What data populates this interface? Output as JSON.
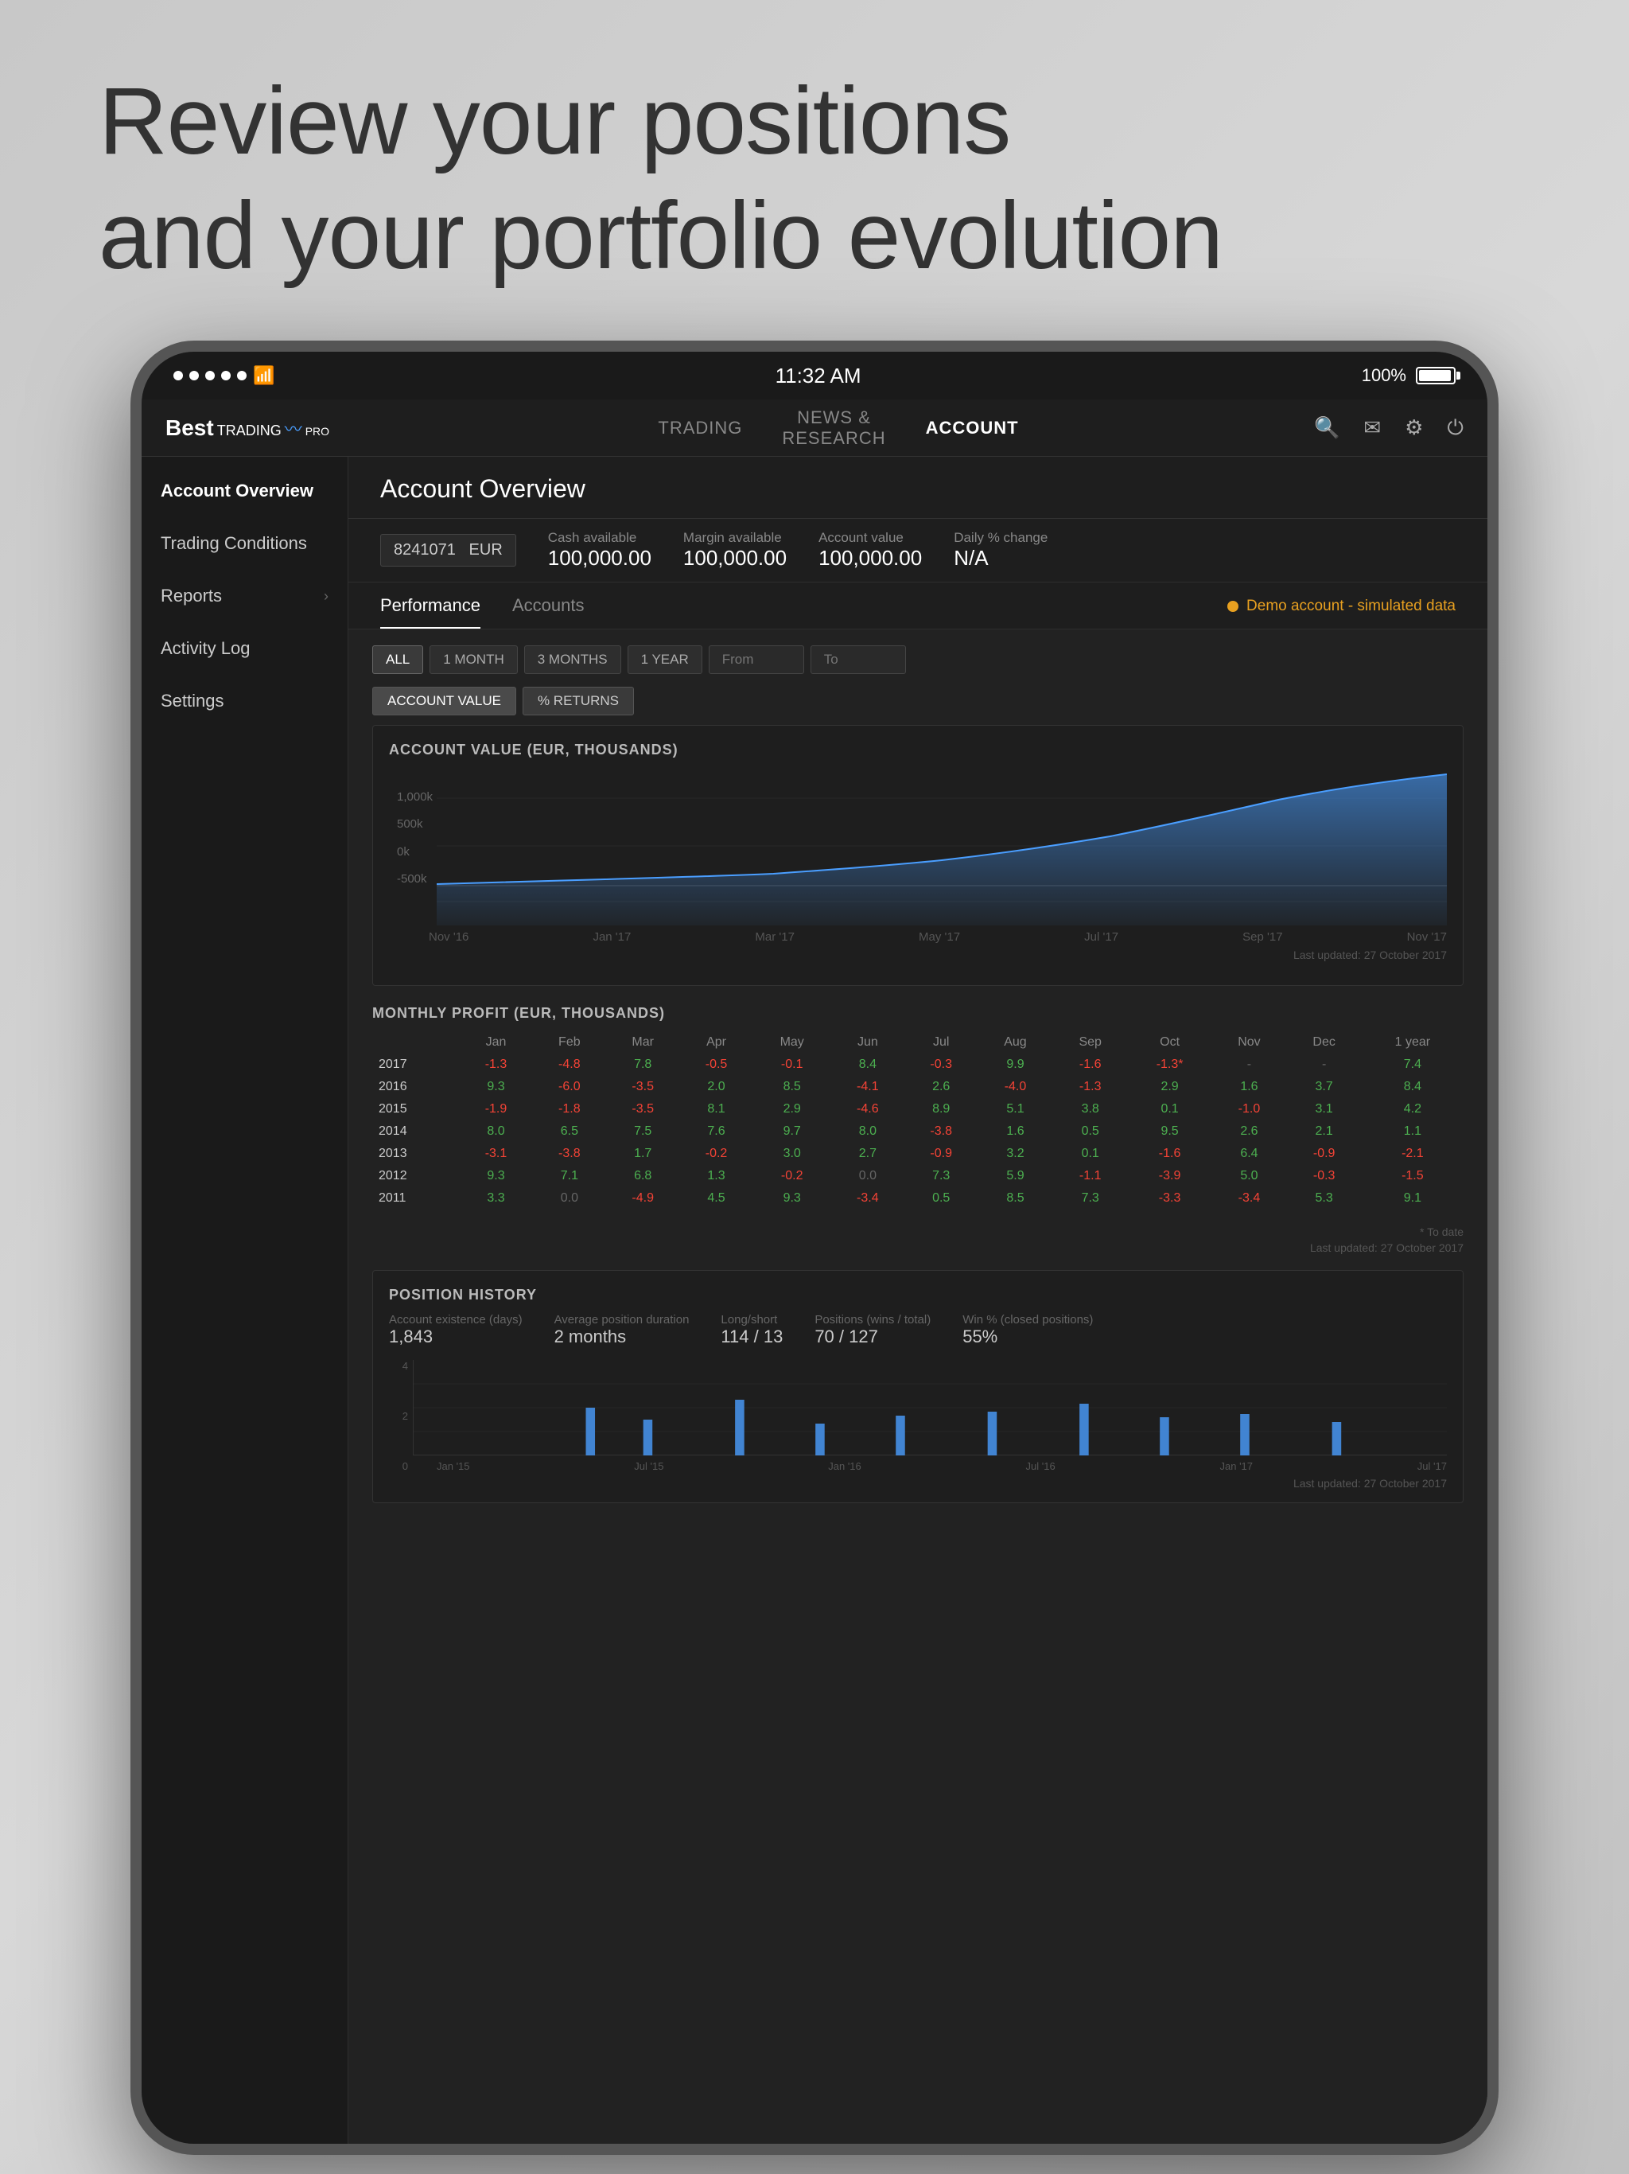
{
  "hero": {
    "line1": "Review your positions",
    "line2": "and your portfolio evolution"
  },
  "device": {
    "statusBar": {
      "time": "11:32 AM",
      "battery": "100%"
    },
    "header": {
      "logo": {
        "best": "Best",
        "trading": "TRADING",
        "pro": "PRO"
      },
      "navTabs": [
        {
          "label": "TRADING",
          "active": false
        },
        {
          "label": "NEWS & RESEARCH",
          "active": false
        },
        {
          "label": "ACCOUNT",
          "active": true
        }
      ]
    },
    "sidebar": {
      "items": [
        {
          "label": "Account Overview",
          "active": true,
          "hasChevron": false
        },
        {
          "label": "Trading Conditions",
          "active": false,
          "hasChevron": false
        },
        {
          "label": "Reports",
          "active": false,
          "hasChevron": true
        },
        {
          "label": "Activity Log",
          "active": false,
          "hasChevron": false
        },
        {
          "label": "Settings",
          "active": false,
          "hasChevron": false
        }
      ]
    },
    "main": {
      "pageTitle": "Account Overview",
      "accountBar": {
        "accountId": "8241071",
        "currency": "EUR",
        "cashAvailable": {
          "label": "Cash available",
          "value": "100,000.00"
        },
        "marginAvailable": {
          "label": "Margin available",
          "value": "100,000.00"
        },
        "accountValue": {
          "label": "Account value",
          "value": "100,000.00"
        },
        "dailyChange": {
          "label": "Daily % change",
          "value": "N/A"
        }
      },
      "subTabs": [
        {
          "label": "Performance",
          "active": true
        },
        {
          "label": "Accounts",
          "active": false
        }
      ],
      "demoBadge": "Demo account - simulated data",
      "timeFilters": [
        {
          "label": "ALL",
          "active": true
        },
        {
          "label": "1 MONTH",
          "active": false
        },
        {
          "label": "3 MONTHS",
          "active": false
        },
        {
          "label": "1 YEAR",
          "active": false
        }
      ],
      "fromLabel": "From",
      "toLabel": "To",
      "chartToggles": [
        {
          "label": "ACCOUNT VALUE",
          "active": true
        },
        {
          "label": "% RETURNS",
          "active": false
        }
      ],
      "accountValueChart": {
        "title": "ACCOUNT VALUE (EUR, THOUSANDS)",
        "yLabels": [
          "1,000k",
          "500k",
          "0k",
          "-500k"
        ],
        "xLabels": [
          "Nov '16",
          "Jan '17",
          "Mar '17",
          "May '17",
          "Jul '17",
          "Sep '17",
          "Nov '17"
        ],
        "lastUpdated": "Last updated: 27 October 2017"
      },
      "monthlyProfit": {
        "title": "MONTHLY PROFIT (EUR, THOUSANDS)",
        "headers": [
          "",
          "Jan",
          "Feb",
          "Mar",
          "Apr",
          "May",
          "Jun",
          "Jul",
          "Aug",
          "Sep",
          "Oct",
          "Nov",
          "Dec",
          "1 year"
        ],
        "rows": [
          {
            "year": "2017",
            "values": [
              "-1.3",
              "-4.8",
              "7.8",
              "-0.5",
              "-0.1",
              "8.4",
              "-0.3",
              "9.9",
              "-1.6",
              "-1.3*",
              "-",
              "-",
              "7.4"
            ],
            "types": [
              "neg",
              "neg",
              "pos",
              "neg",
              "neg",
              "pos",
              "neg",
              "pos",
              "neg",
              "neg",
              "dash",
              "dash",
              "pos"
            ]
          },
          {
            "year": "2016",
            "values": [
              "9.3",
              "-6.0",
              "-3.5",
              "2.0",
              "8.5",
              "-4.1",
              "2.6",
              "-4.0",
              "-1.3",
              "2.9",
              "1.6",
              "3.7",
              "8.4"
            ],
            "types": [
              "pos",
              "neg",
              "neg",
              "pos",
              "pos",
              "neg",
              "pos",
              "neg",
              "neg",
              "pos",
              "pos",
              "pos",
              "pos"
            ]
          },
          {
            "year": "2015",
            "values": [
              "-1.9",
              "-1.8",
              "-3.5",
              "8.1",
              "2.9",
              "-4.6",
              "8.9",
              "5.1",
              "3.8",
              "0.1",
              "-1.0",
              "3.1",
              "4.2"
            ],
            "types": [
              "neg",
              "neg",
              "neg",
              "pos",
              "pos",
              "neg",
              "pos",
              "pos",
              "pos",
              "pos",
              "neg",
              "pos",
              "pos"
            ]
          },
          {
            "year": "2014",
            "values": [
              "8.0",
              "6.5",
              "7.5",
              "7.6",
              "9.7",
              "8.0",
              "-3.8",
              "1.6",
              "0.5",
              "9.5",
              "2.6",
              "2.1",
              "1.1"
            ],
            "types": [
              "pos",
              "pos",
              "pos",
              "pos",
              "pos",
              "pos",
              "neg",
              "pos",
              "pos",
              "pos",
              "pos",
              "pos",
              "pos"
            ]
          },
          {
            "year": "2013",
            "values": [
              "-3.1",
              "-3.8",
              "1.7",
              "-0.2",
              "3.0",
              "2.7",
              "-0.9",
              "3.2",
              "0.1",
              "-1.6",
              "6.4",
              "-0.9",
              "-2.1"
            ],
            "types": [
              "neg",
              "neg",
              "pos",
              "neg",
              "pos",
              "pos",
              "neg",
              "pos",
              "pos",
              "neg",
              "pos",
              "neg",
              "neg"
            ]
          },
          {
            "year": "2012",
            "values": [
              "9.3",
              "7.1",
              "6.8",
              "1.3",
              "-0.2",
              "0.0",
              "7.3",
              "5.9",
              "-1.1",
              "-3.9",
              "5.0",
              "-0.3",
              "-1.5"
            ],
            "types": [
              "pos",
              "pos",
              "pos",
              "pos",
              "neg",
              "dash",
              "pos",
              "pos",
              "neg",
              "neg",
              "pos",
              "neg",
              "neg"
            ]
          },
          {
            "year": "2011",
            "values": [
              "3.3",
              "0.0",
              "-4.9",
              "4.5",
              "9.3",
              "-3.4",
              "0.5",
              "8.5",
              "7.3",
              "-3.3",
              "-3.4",
              "5.3",
              "9.1"
            ],
            "types": [
              "pos",
              "dash",
              "neg",
              "pos",
              "pos",
              "neg",
              "pos",
              "pos",
              "pos",
              "neg",
              "neg",
              "pos",
              "pos"
            ]
          }
        ],
        "footnote": "* To date",
        "lastUpdated": "Last updated: 27 October 2017"
      },
      "positionHistory": {
        "title": "POSITION HISTORY",
        "stats": [
          {
            "label": "Account existence (days)",
            "value": "1,843"
          },
          {
            "label": "Average position duration",
            "value": "2 months"
          },
          {
            "label": "Long/short",
            "value": "114 / 13"
          },
          {
            "label": "Positions (wins / total)",
            "value": "70 / 127"
          },
          {
            "label": "Win % (closed positions)",
            "value": "55%"
          }
        ],
        "chartYLabels": [
          "4",
          "2",
          "0"
        ],
        "xLabels": [
          "Jan '15",
          "Jul '15",
          "Jan '16",
          "Jul '16",
          "Jan '17",
          "Jul '17"
        ],
        "lastUpdated": "Last updated: 27 October 2017"
      }
    }
  }
}
